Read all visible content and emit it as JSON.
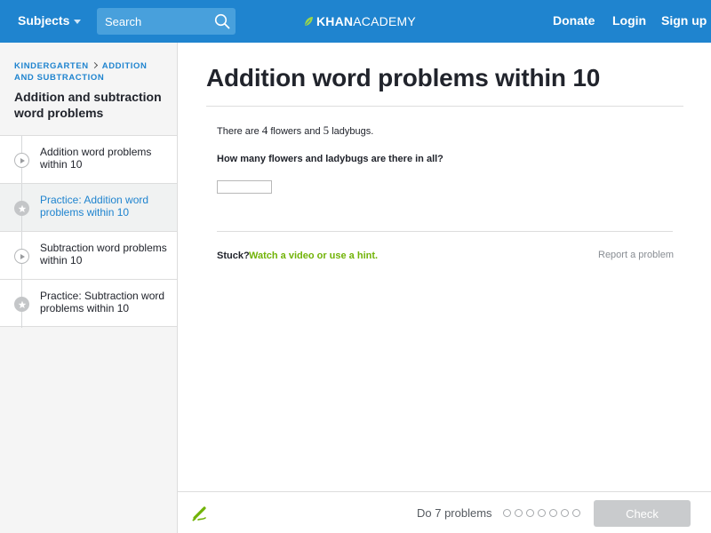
{
  "header": {
    "subjects_label": "Subjects",
    "search_placeholder": "Search",
    "logo_khan": "KHAN",
    "logo_academy": "ACADEMY",
    "donate_label": "Donate",
    "login_label": "Login",
    "signup_label": "Sign up",
    "bar_color": "#1f84cf"
  },
  "sidebar": {
    "breadcrumb": {
      "level1": "KINDERGARTEN",
      "level2": "ADDITION AND SUBTRACTION"
    },
    "unit_title": "Addition and subtraction word problems",
    "lessons": [
      {
        "label": "Addition word problems within 10",
        "icon": "play-icon",
        "active": false
      },
      {
        "label": "Practice: Addition word problems within 10",
        "icon": "star-icon",
        "active": true
      },
      {
        "label": "Subtraction word problems within 10",
        "icon": "play-icon",
        "active": false
      },
      {
        "label": "Practice: Subtraction word problems within 10",
        "icon": "star-icon",
        "active": false
      }
    ]
  },
  "main": {
    "title": "Addition word problems within 10",
    "question": {
      "prefix": "There are",
      "flowers_count": "4",
      "middle": "flowers and",
      "ladybugs_count": "5",
      "suffix": "ladybugs."
    },
    "prompt": "How many flowers and ladybugs are there in all?",
    "answer_value": "",
    "stuck_label": "Stuck?",
    "hint_link": "Watch a video or use a hint.",
    "report_link": "Report a problem"
  },
  "footer": {
    "task_label": "Do 7 problems",
    "problems_total": 7,
    "problems_done": 0,
    "check_label": "Check",
    "hint_color": "#71b307"
  }
}
